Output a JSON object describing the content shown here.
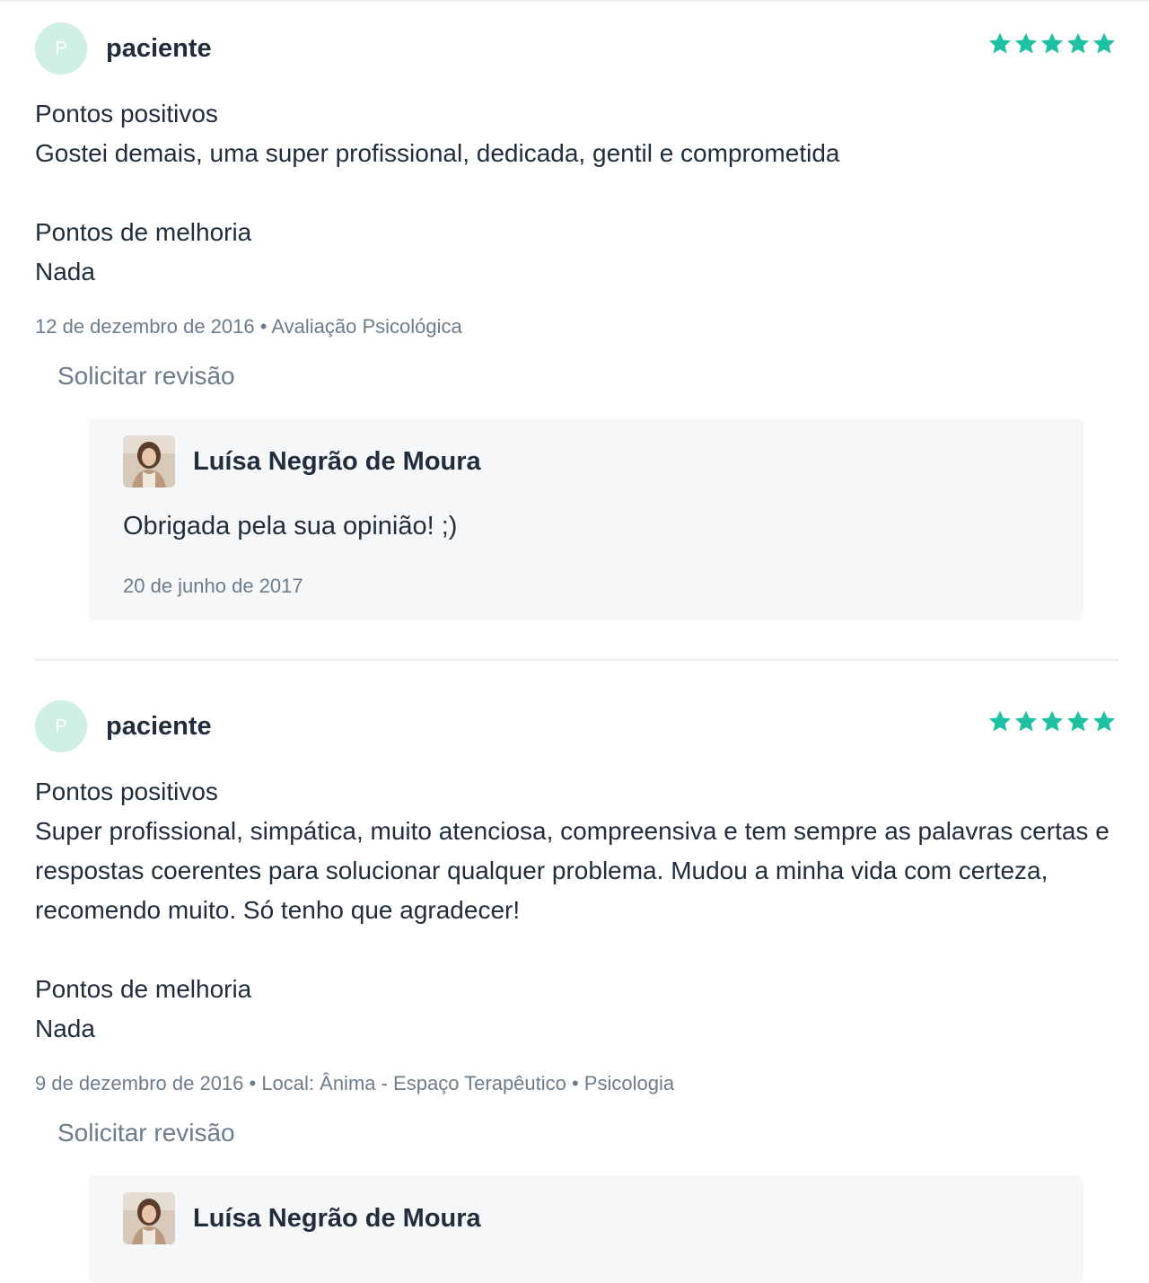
{
  "accent_color": "#1fc1a3",
  "reviews": [
    {
      "avatar_letter": "P",
      "author": "paciente",
      "rating": 5,
      "positives_title": "Pontos positivos",
      "positives_text": "Gostei demais, uma super profissional, dedicada, gentil e comprometida",
      "improvements_title": "Pontos de melhoria",
      "improvements_text": "Nada",
      "meta": "12 de dezembro de 2016 • Avaliação Psicológica",
      "request_review_label": "Solicitar revisão",
      "reply": {
        "name": "Luísa Negrão de Moura",
        "text": "Obrigada pela sua opinião! ;)",
        "date": "20 de junho de 2017"
      }
    },
    {
      "avatar_letter": "P",
      "author": "paciente",
      "rating": 5,
      "positives_title": "Pontos positivos",
      "positives_text": "Super profissional, simpática, muito atenciosa, compreensiva e tem sempre as palavras certas e respostas coerentes para solucionar qualquer problema. Mudou a minha vida com certeza, recomendo muito. Só tenho que agradecer!",
      "improvements_title": "Pontos de melhoria",
      "improvements_text": "Nada",
      "meta": "9 de dezembro de 2016 • Local: Ânima - Espaço Terapêutico • Psicologia",
      "request_review_label": "Solicitar revisão",
      "reply": {
        "name": "Luísa Negrão de Moura"
      }
    }
  ]
}
